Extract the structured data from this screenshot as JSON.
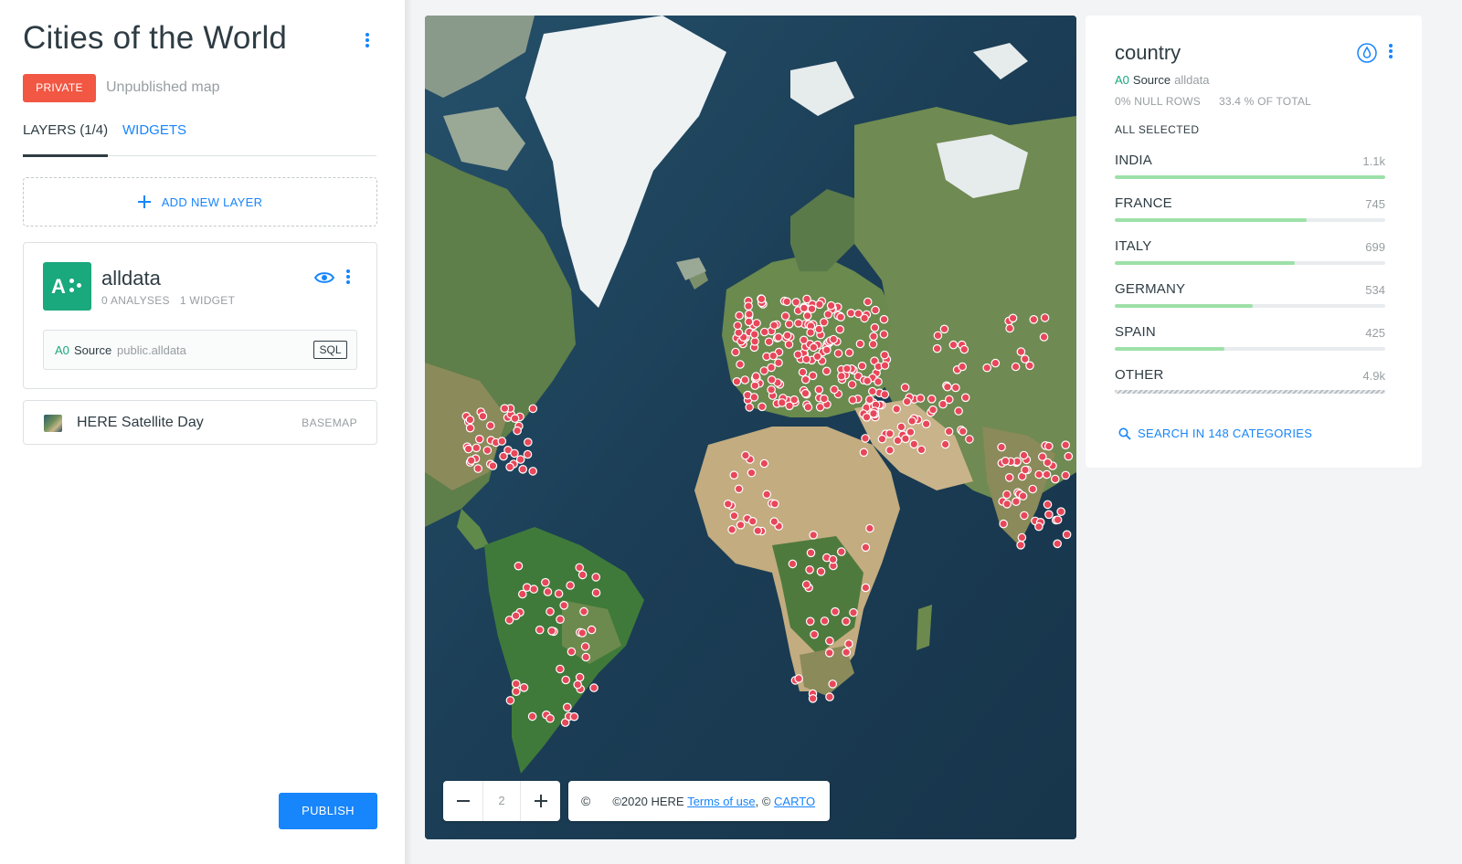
{
  "sidebar": {
    "title": "Cities of the World",
    "privacy_badge": "PRIVATE",
    "publish_status": "Unpublished map",
    "tabs": [
      {
        "label": "LAYERS (1/4)",
        "active": true
      },
      {
        "label": "WIDGETS",
        "active": false
      }
    ],
    "add_layer_label": "ADD NEW LAYER",
    "layer": {
      "tile_letter": "A",
      "name": "alldata",
      "analyses": "0 ANALYSES",
      "widgets": "1 WIDGET",
      "source_id": "A0",
      "source_label": "Source",
      "source_name": "public.alldata",
      "sql_label": "SQL",
      "color": "#1aa87d"
    },
    "basemap": {
      "name": "HERE Satellite Day",
      "tag": "BASEMAP"
    },
    "publish_label": "PUBLISH"
  },
  "map": {
    "zoom_level": "2",
    "attribution_symbol": "©",
    "attribution_prefix": "©2020 HERE",
    "terms_link": "Terms of use",
    "attribution_sep": ", ©",
    "carto_link": "CARTO",
    "point_color": "#e8475a"
  },
  "widget": {
    "title": "country",
    "source_id": "A0",
    "source_label": "Source",
    "source_name": "alldata",
    "null_rows": "0% NULL ROWS",
    "pct_total": "33.4 % OF TOTAL",
    "selection": "ALL SELECTED",
    "categories": [
      {
        "name": "INDIA",
        "value": "1.1k",
        "fraction": 1.0
      },
      {
        "name": "FRANCE",
        "value": "745",
        "fraction": 0.71
      },
      {
        "name": "ITALY",
        "value": "699",
        "fraction": 0.665
      },
      {
        "name": "GERMANY",
        "value": "534",
        "fraction": 0.51
      },
      {
        "name": "SPAIN",
        "value": "425",
        "fraction": 0.405
      },
      {
        "name": "OTHER",
        "value": "4.9k",
        "fraction": 1.0
      }
    ],
    "search_label": "SEARCH IN 148 CATEGORIES",
    "bar_color": "#9de0a8"
  },
  "colors": {
    "accent": "#1785fb",
    "private": "#f15743",
    "source": "#1aa87d"
  }
}
